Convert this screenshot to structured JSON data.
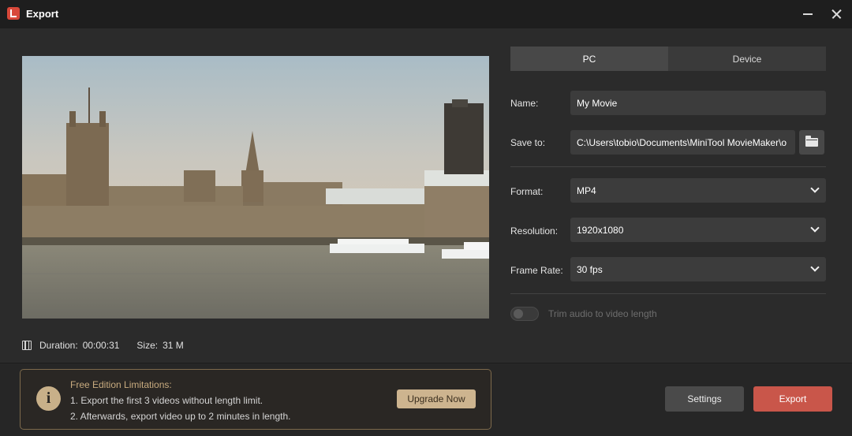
{
  "window": {
    "title": "Export",
    "icon": "minitool-moviemaker-app-icon"
  },
  "preview": {
    "image_subject": "Palace of Westminster across the river"
  },
  "video_info": {
    "duration_label": "Duration:",
    "duration_value": "00:00:31",
    "size_label": "Size:",
    "size_value": "31 M"
  },
  "tabs": [
    {
      "label": "PC",
      "active": true
    },
    {
      "label": "Device",
      "active": false
    }
  ],
  "form": {
    "name_label": "Name:",
    "name_value": "My Movie",
    "save_to_label": "Save to:",
    "save_to_value": "C:\\Users\\tobio\\Documents\\MiniTool MovieMaker\\o",
    "format_label": "Format:",
    "format_value": "MP4",
    "resolution_label": "Resolution:",
    "resolution_value": "1920x1080",
    "frame_rate_label": "Frame Rate:",
    "frame_rate_value": "30 fps",
    "trim_audio_label": "Trim audio to video length",
    "trim_audio_enabled": false
  },
  "limitations": {
    "title": "Free Edition Limitations:",
    "line1": "1. Export the first 3 videos without length limit.",
    "line2": "2. Afterwards, export video up to 2 minutes in length.",
    "upgrade_label": "Upgrade Now"
  },
  "actions": {
    "settings_label": "Settings",
    "export_label": "Export"
  },
  "colors": {
    "accent_export": "#c9564a",
    "upgrade": "#cdb48f",
    "limit_border": "#7d6a4c",
    "limit_title": "#c8ab7f"
  }
}
